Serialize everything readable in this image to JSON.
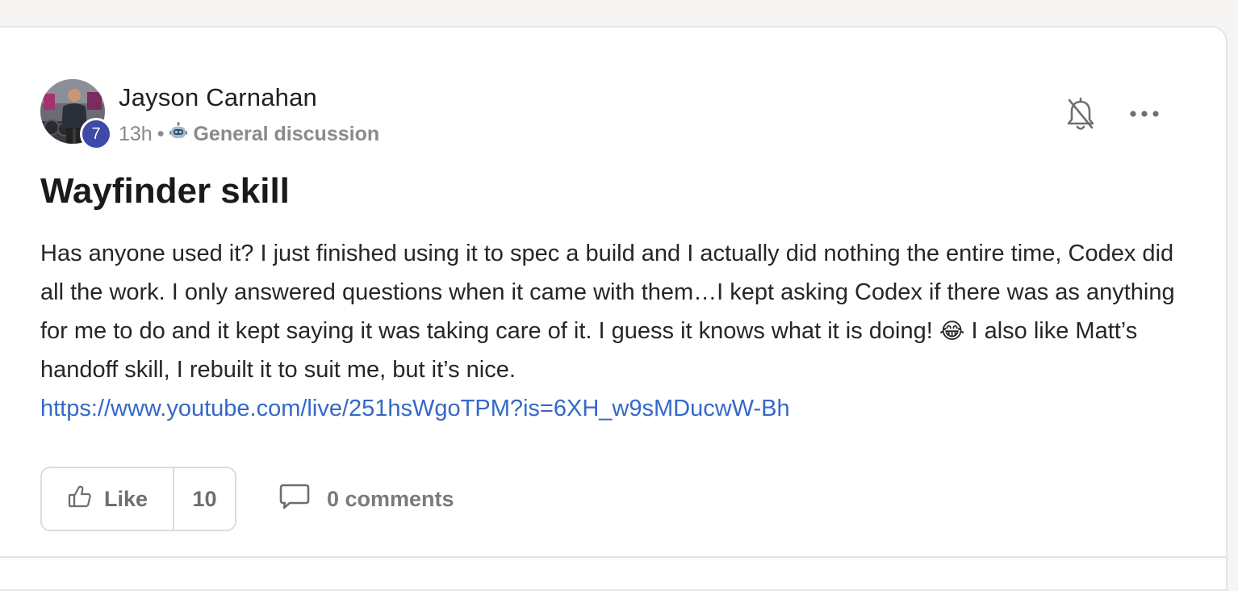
{
  "post": {
    "author": "Jayson Carnahan",
    "level_badge": "7",
    "time": "13h",
    "separator": "•",
    "category": "General discussion",
    "title": "Wayfinder skill",
    "body_part1": "Has anyone used it? I just finished using it to spec a build and I actually did nothing the entire time, Codex did all the work. I only answered questions when it came with them…I kept asking Codex if there was as anything for me to do and it kept saying it was taking care of it. I guess it knows what it is doing!",
    "emoji": "😂",
    "body_part2": "I also like Matt’s handoff skill, I rebuilt it to suit me, but it’s nice.",
    "link": "https://www.youtube.com/live/251hsWgoTPM?is=6XH_w9sMDucwW-Bh"
  },
  "actions": {
    "like_label": "Like",
    "like_count": "10",
    "comments_label": "0 comments"
  },
  "icons": {
    "avatar": "user-avatar",
    "category": "robot-icon",
    "notifications": "bell-off-icon",
    "more": "more-dots-icon",
    "like": "thumbs-up-icon",
    "comments": "comment-bubble-icon"
  },
  "colors": {
    "link": "#3568c8",
    "badge": "#3e4aa8",
    "text": "#262626",
    "muted": "#8a8a8a"
  }
}
